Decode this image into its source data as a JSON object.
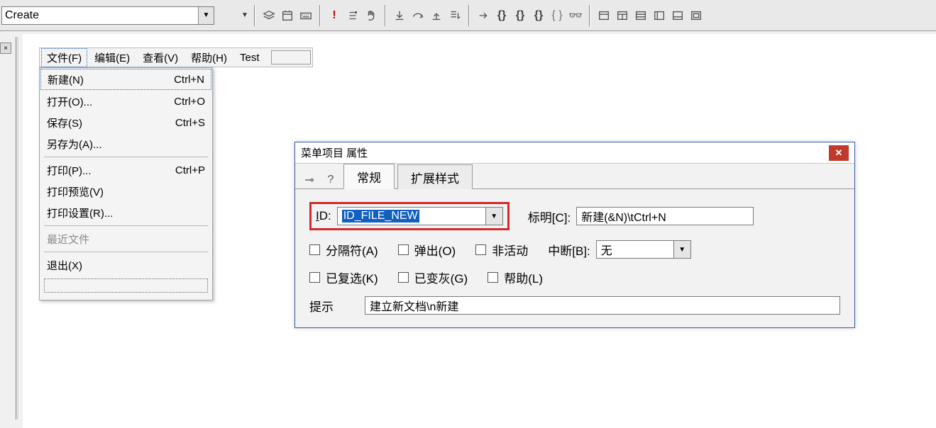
{
  "top_combo": {
    "value": "Create"
  },
  "menu_bar": {
    "file": "文件(F)",
    "edit": "编辑(E)",
    "view": "查看(V)",
    "help": "帮助(H)",
    "test": "Test"
  },
  "dropdown": {
    "new": {
      "label": "新建(N)",
      "shortcut": "Ctrl+N"
    },
    "open": {
      "label": "打开(O)...",
      "shortcut": "Ctrl+O"
    },
    "save": {
      "label": "保存(S)",
      "shortcut": "Ctrl+S"
    },
    "saveas": {
      "label": "另存为(A)...",
      "shortcut": ""
    },
    "print": {
      "label": "打印(P)...",
      "shortcut": "Ctrl+P"
    },
    "preview": {
      "label": "打印预览(V)",
      "shortcut": ""
    },
    "printsetup": {
      "label": "打印设置(R)...",
      "shortcut": ""
    },
    "recent": {
      "label": "最近文件",
      "shortcut": ""
    },
    "exit": {
      "label": "退出(X)",
      "shortcut": ""
    }
  },
  "dialog": {
    "title": "菜单项目 属性",
    "tabs": {
      "general": "常规",
      "extended": "扩展样式"
    },
    "id_label": "ID:",
    "id_value": "ID_FILE_NEW",
    "caption_label": "标明[C]:",
    "caption_value": "新建(&N)\\tCtrl+N",
    "chk_separator": "分隔符(A)",
    "chk_popup": "弹出(O)",
    "chk_inactive": "非活动",
    "break_label": "中断[B]:",
    "break_value": "无",
    "chk_checked": "已复选(K)",
    "chk_grayed": "已变灰(G)",
    "chk_help": "帮助(L)",
    "prompt_label": "提示",
    "prompt_value": "建立新文档\\n新建"
  }
}
